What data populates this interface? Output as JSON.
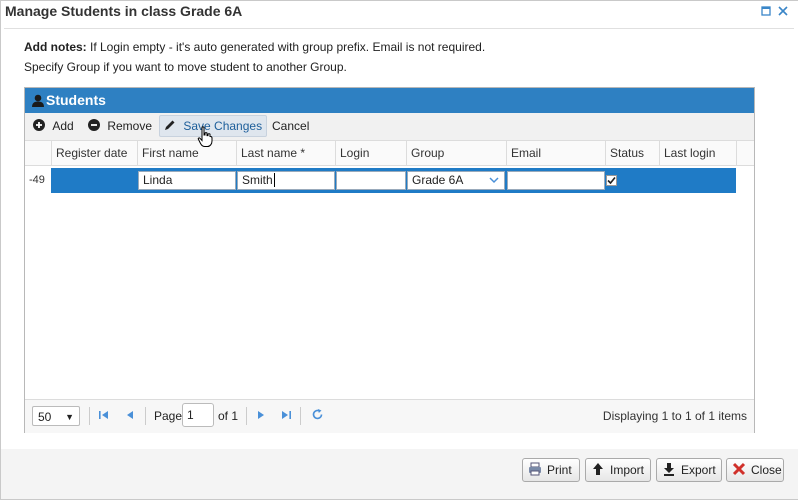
{
  "window": {
    "title": "Manage Students in class Grade 6A"
  },
  "notes": {
    "bold": "Add notes:",
    "line1": " If Login empty - it's auto generated with group prefix. Email is not required.",
    "line2": "Specify Group if you want to move student to another Group."
  },
  "panel": {
    "title": "Students"
  },
  "toolbar": {
    "add": "Add",
    "remove": "Remove",
    "save": "Save Changes",
    "cancel": "Cancel"
  },
  "columns": [
    "Register date",
    "First name",
    "Last name *",
    "Login",
    "Group",
    "Email",
    "Status",
    "Last login"
  ],
  "row": {
    "num": "-49",
    "register_date": "",
    "first_name": "Linda",
    "last_name": "Smith",
    "login": "",
    "group": "Grade 6A",
    "email": "",
    "status_checked": true,
    "last_login": ""
  },
  "pager": {
    "page_size": "50",
    "page_label": "Page",
    "page_value": "1",
    "of_label": "of 1",
    "status": "Displaying 1 to 1 of 1 items"
  },
  "footer": {
    "print": "Print",
    "import": "Import",
    "export": "Export",
    "close": "Close"
  },
  "colors": {
    "accent": "#2e80c2",
    "selection": "#1f7bc6",
    "close_red": "#d0302a"
  }
}
